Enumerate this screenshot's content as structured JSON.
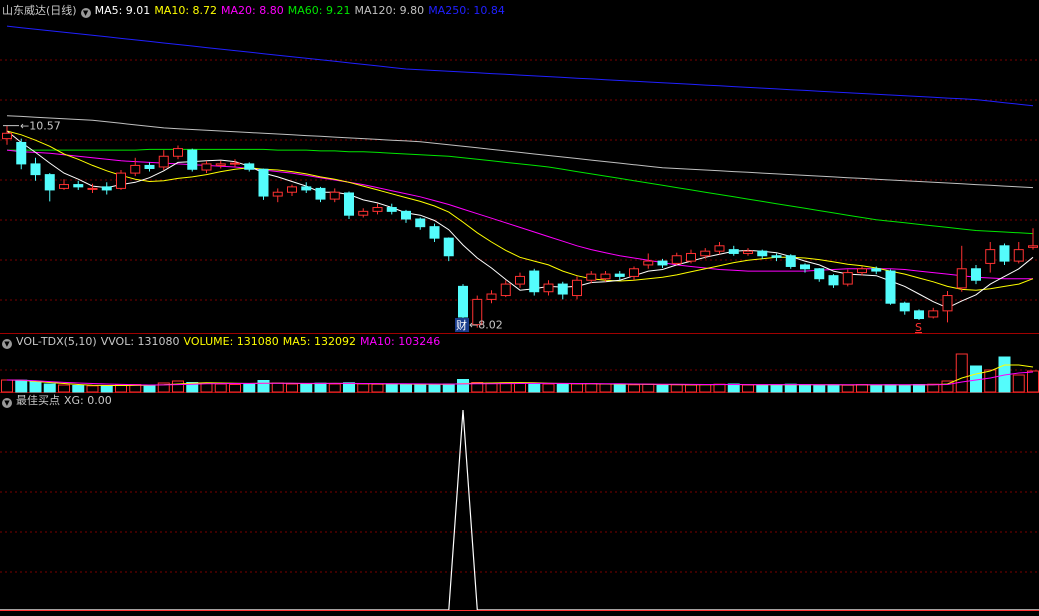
{
  "colors": {
    "up": "#ff3232",
    "down": "#54fcfc",
    "grid": "#7a0000",
    "separator": "#a00000",
    "ma5": "#ffffff",
    "ma10": "#ffff00",
    "ma20": "#ff00ff",
    "ma60": "#00e600",
    "ma120": "#c0c0c0",
    "ma250": "#2020ff",
    "label": "#c8c8c8"
  },
  "price_legend": {
    "title": "山东威达(日线)",
    "ma5": "MA5: 9.01",
    "ma10": "MA10: 8.72",
    "ma20": "MA20: 8.80",
    "ma60": "MA60: 9.21",
    "ma120": "MA120: 9.80",
    "ma250": "MA250: 10.84"
  },
  "volume_legend": {
    "title": "VOL-TDX(5,10)",
    "vvol": "VVOL: 131080",
    "volume": "VOLUME: 131080",
    "ma5": "MA5: 132092",
    "ma10": "MA10: 103246"
  },
  "signal_legend": {
    "title": "最佳买点",
    "xg": "XG: 0.00"
  },
  "annotations": {
    "high": "10.57",
    "low": "8.02",
    "cai": "财",
    "s": "S"
  },
  "chart_data": [
    {
      "type": "candlestick",
      "candles": [
        [
          10.45,
          10.52,
          10.62,
          10.37
        ],
        [
          10.4,
          10.12,
          10.45,
          10.05
        ],
        [
          10.12,
          9.98,
          10.2,
          9.9
        ],
        [
          9.98,
          9.78,
          10.0,
          9.63
        ],
        [
          9.8,
          9.85,
          9.92,
          9.78
        ],
        [
          9.85,
          9.82,
          9.9,
          9.78
        ],
        [
          9.8,
          9.8,
          9.86,
          9.74
        ],
        [
          9.82,
          9.78,
          9.88,
          9.72
        ],
        [
          9.8,
          10.0,
          10.04,
          9.78
        ],
        [
          10.0,
          10.1,
          10.2,
          9.96
        ],
        [
          10.1,
          10.06,
          10.14,
          10.02
        ],
        [
          10.08,
          10.22,
          10.3,
          10.04
        ],
        [
          10.22,
          10.32,
          10.36,
          10.18
        ],
        [
          10.3,
          10.05,
          10.32,
          10.02
        ],
        [
          10.04,
          10.12,
          10.16,
          10.0
        ],
        [
          10.1,
          10.12,
          10.16,
          10.06
        ],
        [
          10.12,
          10.13,
          10.18,
          10.08
        ],
        [
          10.12,
          10.05,
          10.14,
          10.02
        ],
        [
          10.05,
          9.7,
          10.06,
          9.65
        ],
        [
          9.7,
          9.75,
          9.8,
          9.62
        ],
        [
          9.75,
          9.82,
          9.85,
          9.7
        ],
        [
          9.82,
          9.78,
          9.88,
          9.74
        ],
        [
          9.8,
          9.66,
          9.82,
          9.62
        ],
        [
          9.66,
          9.75,
          9.8,
          9.62
        ],
        [
          9.74,
          9.45,
          9.76,
          9.4
        ],
        [
          9.45,
          9.5,
          9.54,
          9.42
        ],
        [
          9.5,
          9.55,
          9.6,
          9.46
        ],
        [
          9.55,
          9.5,
          9.6,
          9.46
        ],
        [
          9.5,
          9.4,
          9.52,
          9.35
        ],
        [
          9.4,
          9.3,
          9.42,
          9.26
        ],
        [
          9.3,
          9.15,
          9.34,
          9.1
        ],
        [
          9.15,
          8.92,
          9.16,
          8.85
        ],
        [
          8.52,
          8.12,
          8.55,
          8.02
        ],
        [
          8.02,
          8.35,
          8.4,
          7.98
        ],
        [
          8.35,
          8.42,
          8.47,
          8.3
        ],
        [
          8.4,
          8.55,
          8.6,
          8.38
        ],
        [
          8.55,
          8.65,
          8.7,
          8.5
        ],
        [
          8.72,
          8.45,
          8.75,
          8.4
        ],
        [
          8.45,
          8.55,
          8.6,
          8.4
        ],
        [
          8.55,
          8.42,
          8.58,
          8.35
        ],
        [
          8.4,
          8.6,
          8.65,
          8.35
        ],
        [
          8.6,
          8.68,
          8.72,
          8.56
        ],
        [
          8.62,
          8.68,
          8.72,
          8.58
        ],
        [
          8.68,
          8.65,
          8.72,
          8.6
        ],
        [
          8.65,
          8.75,
          8.78,
          8.6
        ],
        [
          8.8,
          8.85,
          8.95,
          8.75
        ],
        [
          8.85,
          8.8,
          8.88,
          8.76
        ],
        [
          8.82,
          8.92,
          8.96,
          8.8
        ],
        [
          8.85,
          8.95,
          9.0,
          8.82
        ],
        [
          8.92,
          8.98,
          9.02,
          8.88
        ],
        [
          8.98,
          9.05,
          9.1,
          8.94
        ],
        [
          9.0,
          8.95,
          9.05,
          8.92
        ],
        [
          8.95,
          8.98,
          9.02,
          8.92
        ],
        [
          8.98,
          8.92,
          9.0,
          8.88
        ],
        [
          8.92,
          8.9,
          8.95,
          8.85
        ],
        [
          8.92,
          8.78,
          8.94,
          8.75
        ],
        [
          8.8,
          8.75,
          8.82,
          8.7
        ],
        [
          8.75,
          8.62,
          8.76,
          8.58
        ],
        [
          8.66,
          8.54,
          8.68,
          8.5
        ],
        [
          8.55,
          8.7,
          8.74,
          8.52
        ],
        [
          8.7,
          8.75,
          8.78,
          8.66
        ],
        [
          8.75,
          8.72,
          8.78,
          8.68
        ],
        [
          8.72,
          8.3,
          8.74,
          8.28
        ],
        [
          8.3,
          8.2,
          8.32,
          8.15
        ],
        [
          8.2,
          8.1,
          8.22,
          8.08
        ],
        [
          8.12,
          8.2,
          8.24,
          8.1
        ],
        [
          8.2,
          8.4,
          8.46,
          8.05
        ],
        [
          8.5,
          8.75,
          9.05,
          8.45
        ],
        [
          8.75,
          8.6,
          8.8,
          8.55
        ],
        [
          8.82,
          9.0,
          9.1,
          8.7
        ],
        [
          9.05,
          8.85,
          9.08,
          8.8
        ],
        [
          8.85,
          9.0,
          9.1,
          8.82
        ],
        [
          9.03,
          9.05,
          9.28,
          9.0
        ]
      ],
      "moving_averages": {
        "MA5": [
          10.55,
          10.4,
          10.27,
          10.13,
          10.0,
          9.92,
          9.83,
          9.81,
          9.85,
          9.88,
          9.94,
          10.03,
          10.14,
          10.15,
          10.16,
          10.17,
          10.15,
          10.09,
          10.0,
          9.95,
          9.89,
          9.83,
          9.75,
          9.75,
          9.72,
          9.65,
          9.61,
          9.55,
          9.48,
          9.45,
          9.38,
          9.26,
          9.06,
          8.89,
          8.76,
          8.61,
          8.47,
          8.49,
          8.52,
          8.51,
          8.52,
          8.57,
          8.58,
          8.6,
          8.66,
          8.72,
          8.74,
          8.8,
          8.85,
          8.9,
          8.94,
          8.98,
          8.99,
          8.98,
          8.96,
          8.91,
          8.85,
          8.8,
          8.72,
          8.68,
          8.67,
          8.66,
          8.59,
          8.52,
          8.42,
          8.32,
          8.24,
          8.33,
          8.41,
          8.55,
          8.65,
          8.75,
          8.9
        ],
        "MA10": [
          10.55,
          10.5,
          10.43,
          10.35,
          10.25,
          10.18,
          10.1,
          10.03,
          9.97,
          9.92,
          9.89,
          9.9,
          9.93,
          9.95,
          9.98,
          10.02,
          10.05,
          10.07,
          10.05,
          10.04,
          10.02,
          9.99,
          9.95,
          9.92,
          9.88,
          9.83,
          9.78,
          9.73,
          9.68,
          9.63,
          9.57,
          9.49,
          9.36,
          9.22,
          9.1,
          8.99,
          8.9,
          8.85,
          8.8,
          8.72,
          8.66,
          8.62,
          8.6,
          8.59,
          8.6,
          8.62,
          8.64,
          8.67,
          8.71,
          8.75,
          8.79,
          8.83,
          8.86,
          8.88,
          8.9,
          8.9,
          8.89,
          8.87,
          8.84,
          8.81,
          8.79,
          8.76,
          8.72,
          8.68,
          8.63,
          8.58,
          8.52,
          8.48,
          8.47,
          8.49,
          8.52,
          8.55,
          8.62
        ],
        "MA20": [
          10.3,
          10.28,
          10.27,
          10.26,
          10.24,
          10.22,
          10.2,
          10.18,
          10.16,
          10.15,
          10.14,
          10.13,
          10.12,
          10.11,
          10.1,
          10.09,
          10.08,
          10.06,
          10.04,
          10.02,
          10.0,
          9.97,
          9.94,
          9.91,
          9.88,
          9.85,
          9.81,
          9.77,
          9.73,
          9.69,
          9.64,
          9.59,
          9.53,
          9.47,
          9.41,
          9.35,
          9.29,
          9.23,
          9.17,
          9.11,
          9.05,
          9.0,
          8.96,
          8.92,
          8.89,
          8.86,
          8.83,
          8.8,
          8.78,
          8.76,
          8.74,
          8.73,
          8.72,
          8.72,
          8.72,
          8.72,
          8.72,
          8.73,
          8.74,
          8.75,
          8.75,
          8.75,
          8.75,
          8.74,
          8.72,
          8.7,
          8.68,
          8.66,
          8.64,
          8.63,
          8.62,
          8.62,
          8.62
        ],
        "MA60": [
          10.3,
          10.3,
          10.3,
          10.3,
          10.3,
          10.3,
          10.3,
          10.3,
          10.3,
          10.3,
          10.31,
          10.31,
          10.31,
          10.31,
          10.31,
          10.31,
          10.31,
          10.31,
          10.31,
          10.3,
          10.3,
          10.3,
          10.29,
          10.29,
          10.28,
          10.28,
          10.27,
          10.26,
          10.25,
          10.24,
          10.23,
          10.22,
          10.2,
          10.18,
          10.16,
          10.14,
          10.12,
          10.1,
          10.08,
          10.05,
          10.02,
          9.99,
          9.96,
          9.93,
          9.9,
          9.87,
          9.84,
          9.81,
          9.78,
          9.75,
          9.72,
          9.69,
          9.66,
          9.63,
          9.6,
          9.57,
          9.54,
          9.51,
          9.48,
          9.45,
          9.42,
          9.39,
          9.37,
          9.35,
          9.33,
          9.31,
          9.29,
          9.27,
          9.25,
          9.24,
          9.23,
          9.22,
          9.21
        ],
        "MA120": [
          10.75,
          10.74,
          10.73,
          10.72,
          10.71,
          10.7,
          10.69,
          10.67,
          10.65,
          10.63,
          10.61,
          10.59,
          10.58,
          10.57,
          10.56,
          10.55,
          10.54,
          10.53,
          10.52,
          10.51,
          10.5,
          10.49,
          10.48,
          10.47,
          10.46,
          10.45,
          10.44,
          10.43,
          10.42,
          10.41,
          10.39,
          10.37,
          10.35,
          10.33,
          10.31,
          10.29,
          10.27,
          10.25,
          10.23,
          10.21,
          10.19,
          10.17,
          10.15,
          10.13,
          10.11,
          10.09,
          10.07,
          10.06,
          10.05,
          10.04,
          10.03,
          10.02,
          10.01,
          10.0,
          9.99,
          9.98,
          9.97,
          9.96,
          9.95,
          9.94,
          9.93,
          9.92,
          9.91,
          9.9,
          9.89,
          9.88,
          9.87,
          9.86,
          9.85,
          9.84,
          9.83,
          9.82,
          9.81
        ],
        "MA250": [
          11.92,
          11.9,
          11.88,
          11.86,
          11.84,
          11.82,
          11.8,
          11.78,
          11.76,
          11.74,
          11.72,
          11.7,
          11.68,
          11.66,
          11.64,
          11.62,
          11.6,
          11.58,
          11.56,
          11.54,
          11.52,
          11.5,
          11.48,
          11.46,
          11.44,
          11.42,
          11.4,
          11.38,
          11.36,
          11.35,
          11.34,
          11.33,
          11.32,
          11.31,
          11.3,
          11.29,
          11.28,
          11.27,
          11.26,
          11.25,
          11.24,
          11.23,
          11.22,
          11.21,
          11.2,
          11.19,
          11.18,
          11.17,
          11.16,
          11.15,
          11.14,
          11.13,
          11.12,
          11.11,
          11.1,
          11.09,
          11.08,
          11.07,
          11.06,
          11.05,
          11.04,
          11.03,
          11.02,
          11.01,
          11.0,
          10.99,
          10.98,
          10.97,
          10.96,
          10.94,
          10.92,
          10.9,
          10.88
        ]
      },
      "high_label_index": 0,
      "low_label_index": 32,
      "cai_index": 32,
      "s_index": 64
    },
    {
      "type": "bar",
      "volume": [
        120000,
        118000,
        100000,
        80000,
        70000,
        65000,
        62000,
        60000,
        70000,
        75000,
        68000,
        90000,
        110000,
        95000,
        85000,
        80000,
        75000,
        85000,
        115000,
        90000,
        80000,
        82000,
        88000,
        80000,
        92000,
        82000,
        78000,
        80000,
        76000,
        74000,
        75000,
        80000,
        125000,
        95000,
        90000,
        92000,
        88000,
        85000,
        80000,
        78000,
        82000,
        84000,
        80000,
        76000,
        72000,
        78000,
        74000,
        72000,
        70000,
        74000,
        78000,
        80000,
        70000,
        68000,
        72000,
        78000,
        75000,
        70000,
        72000,
        68000,
        75000,
        70000,
        72000,
        68000,
        75000,
        78000,
        110000,
        380000,
        260000,
        220000,
        350000,
        170000,
        210000
      ],
      "vol_ma5": [
        120000,
        118000,
        105000,
        95000,
        85000,
        75000,
        68000,
        65000,
        65000,
        66000,
        68000,
        72000,
        80000,
        88000,
        92000,
        90000,
        88000,
        85000,
        87000,
        88000,
        86000,
        84000,
        85000,
        86000,
        85000,
        83000,
        82000,
        81000,
        80000,
        78000,
        77000,
        76000,
        85000,
        88000,
        90000,
        92000,
        94000,
        92000,
        88000,
        85000,
        83000,
        82000,
        80000,
        79000,
        77000,
        76000,
        75000,
        74000,
        73000,
        73000,
        74000,
        75000,
        74000,
        73000,
        73000,
        73000,
        73000,
        72000,
        72000,
        71000,
        71000,
        71000,
        71000,
        71000,
        72000,
        73000,
        80000,
        140000,
        180000,
        210000,
        270000,
        270000,
        250000
      ],
      "vol_ma10": [
        120000,
        119000,
        112000,
        104000,
        96000,
        90000,
        85000,
        80000,
        76000,
        73000,
        70000,
        71000,
        74000,
        78000,
        82000,
        84000,
        85000,
        86000,
        88000,
        88000,
        87000,
        86000,
        86000,
        86000,
        86000,
        85000,
        84000,
        83000,
        82000,
        81000,
        80000,
        79000,
        81000,
        82000,
        83000,
        84000,
        85000,
        86000,
        86000,
        86000,
        85000,
        84000,
        83000,
        82000,
        80000,
        79000,
        78000,
        77000,
        76000,
        75000,
        75000,
        75000,
        74000,
        74000,
        74000,
        74000,
        74000,
        73000,
        73000,
        72000,
        72000,
        72000,
        72000,
        72000,
        72000,
        72000,
        75000,
        100000,
        120000,
        140000,
        170000,
        190000,
        200000
      ],
      "ylim": [
        0,
        400000
      ]
    },
    {
      "type": "line",
      "x_peak_index": 32,
      "xg": [
        0,
        0,
        0,
        0,
        0,
        0,
        0,
        0,
        0,
        0,
        0,
        0,
        0,
        0,
        0,
        0,
        0,
        0,
        0,
        0,
        0,
        0,
        0,
        0,
        0,
        0,
        0,
        0,
        0,
        0,
        0,
        0,
        1,
        0,
        0,
        0,
        0,
        0,
        0,
        0,
        0,
        0,
        0,
        0,
        0,
        0,
        0,
        0,
        0,
        0,
        0,
        0,
        0,
        0,
        0,
        0,
        0,
        0,
        0,
        0,
        0,
        0,
        0,
        0,
        0,
        0,
        0,
        0,
        0,
        0,
        0,
        0,
        0
      ],
      "ylim": [
        0,
        1
      ]
    }
  ]
}
